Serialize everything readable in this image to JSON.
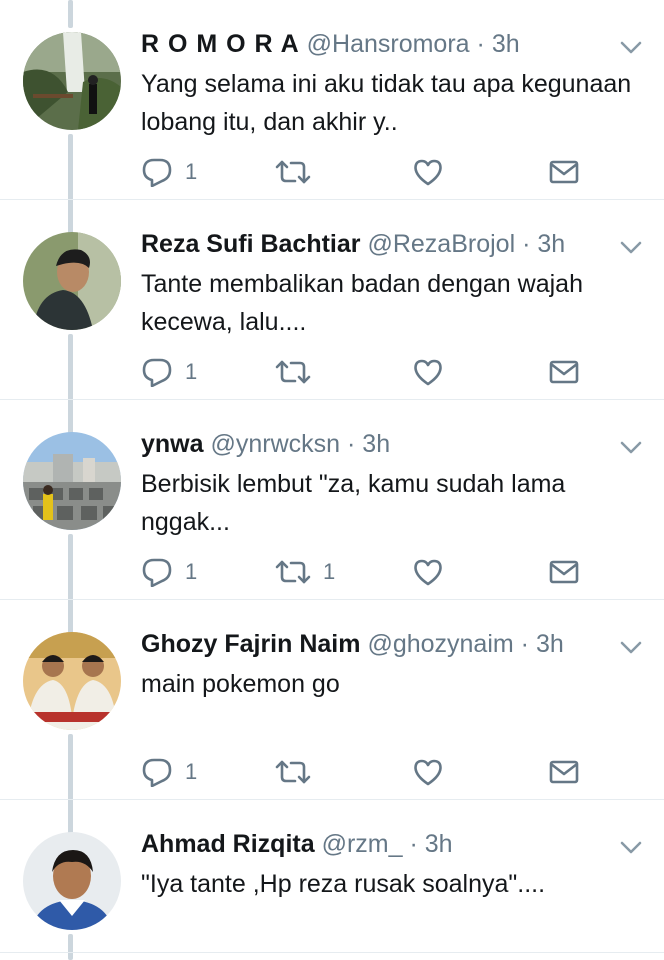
{
  "tweets": [
    {
      "name": "R O M O R A",
      "handle": "@Hansromora",
      "dot": "·",
      "time": "3h",
      "text": "Yang selama ini aku tidak tau apa kegunaan lobang itu, dan akhir y..",
      "replies": "1",
      "retweets": "",
      "likes": ""
    },
    {
      "name": "Reza Sufi Bachtiar",
      "handle": "@RezaBrojol",
      "dot": "·",
      "time": "3h",
      "text": "Tante membalikan badan dengan wajah kecewa, lalu....",
      "replies": "1",
      "retweets": "",
      "likes": ""
    },
    {
      "name": "ynwa",
      "handle": "@ynrwcksn",
      "dot": "·",
      "time": "3h",
      "text": "Berbisik lembut \"za, kamu sudah lama nggak...",
      "replies": "1",
      "retweets": "1",
      "likes": ""
    },
    {
      "name": "Ghozy Fajrin Naim",
      "handle": "@ghozynaim",
      "dot": "·",
      "time": "3h",
      "text": "main pokemon go",
      "replies": "1",
      "retweets": "",
      "likes": ""
    },
    {
      "name": "Ahmad Rizqita",
      "handle": "@rzm_",
      "dot": "·",
      "time": "3h",
      "text": "\"Iya tante ,Hp reza rusak soalnya\"....",
      "replies": "",
      "retweets": "",
      "likes": ""
    }
  ],
  "icons": {
    "reply": "reply-icon",
    "retweet": "retweet-icon",
    "like": "heart-icon",
    "dm": "envelope-icon",
    "menu": "chevron-down-icon"
  },
  "colors": {
    "icon": "#657786",
    "thread_line": "#ccd6dd",
    "name": "#14171a",
    "meta": "#657786"
  }
}
